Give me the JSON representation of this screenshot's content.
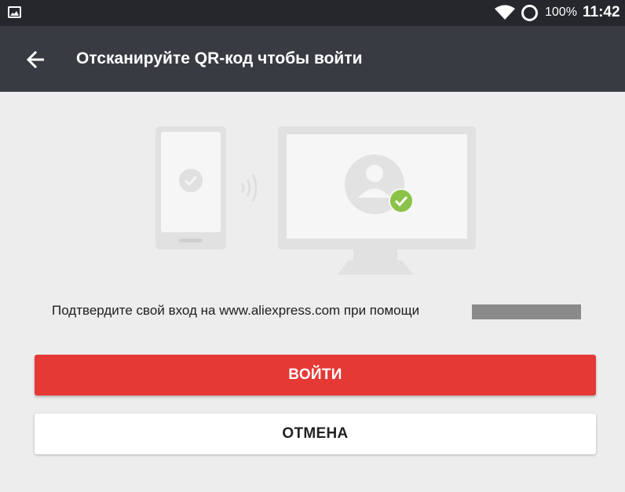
{
  "status_bar": {
    "battery": "100%",
    "time": "11:42",
    "icons": [
      "image-notification-icon",
      "wifi-icon",
      "battery-ring-icon"
    ]
  },
  "toolbar": {
    "title": "Отсканируйте QR-код чтобы войти",
    "back_icon": "arrow-left-icon"
  },
  "illustration": {
    "icons": [
      "phone-icon",
      "check-circle-icon",
      "signal-waves-icon",
      "monitor-icon",
      "user-avatar-icon",
      "green-check-badge-icon"
    ]
  },
  "main": {
    "message": "Подтвердите свой вход на www.aliexpress.com при помощи"
  },
  "buttons": {
    "login_label": "ВОЙТИ",
    "cancel_label": "ОТМЕНА"
  },
  "colors": {
    "status_bar": "#25272c",
    "toolbar": "#383b42",
    "background": "#ededee",
    "accent": "#e53936",
    "success": "#8bc34a"
  }
}
